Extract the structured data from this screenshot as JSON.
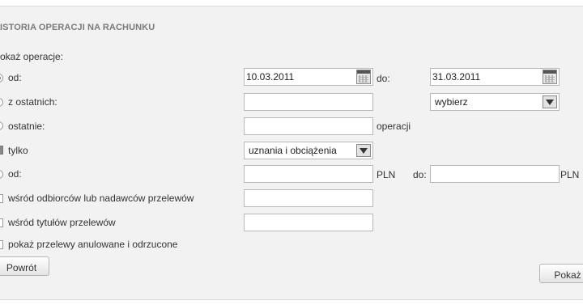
{
  "panel": {
    "title": "ISTORIA OPERACJI NA RACHUNKU",
    "show_label": "okaż operacje:"
  },
  "filters": {
    "date_range": {
      "label": "od:",
      "from_value": "10.03.2011",
      "to_label": "do:",
      "to_value": "31.03.2011",
      "checked": true
    },
    "last_period": {
      "label": "z ostatnich:",
      "value": "",
      "select_value": "wybierz"
    },
    "last_count": {
      "label": "ostatnie:",
      "value": "",
      "unit": "operacji"
    },
    "only": {
      "label": "tylko",
      "select_value": "uznania i obciążenia",
      "checked": true
    },
    "amount": {
      "label": "od:",
      "from_value": "",
      "currency": "PLN",
      "to_label": "do:",
      "to_value": "",
      "to_currency": "PLN"
    },
    "recipients": {
      "label": "wśród odbiorców lub nadawców przelewów",
      "value": ""
    },
    "titles": {
      "label": "wśród tytułów przelewów",
      "value": ""
    },
    "cancelled": {
      "label": "pokaż przelewy anulowane i odrzucone"
    }
  },
  "buttons": {
    "back": "Powrót",
    "show": "Pokaż"
  }
}
